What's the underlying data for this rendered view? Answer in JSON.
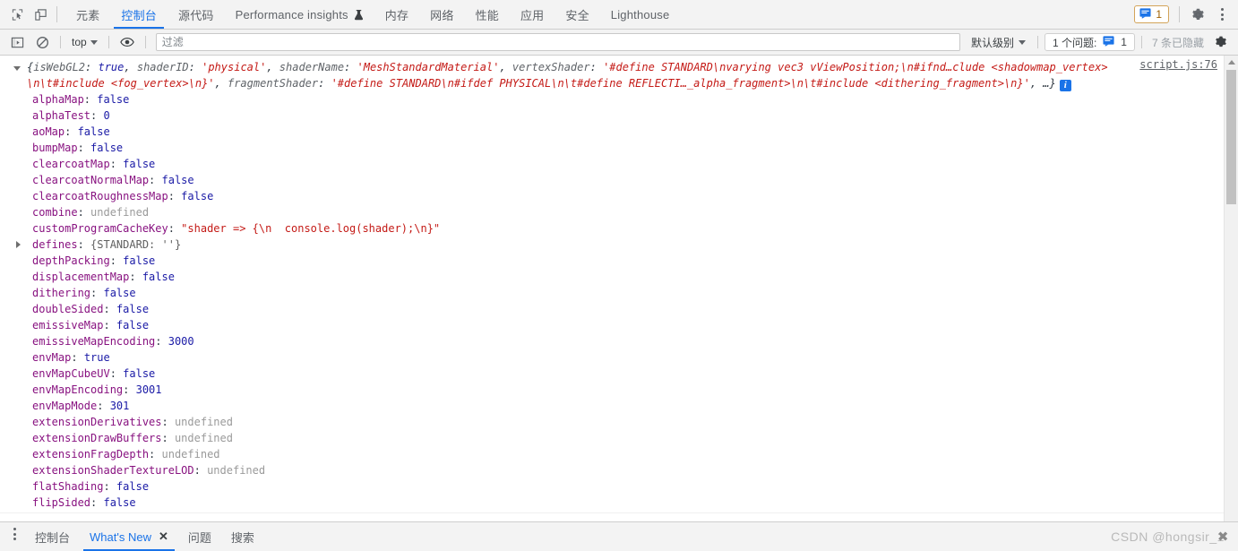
{
  "toolbar": {
    "inspect_icon": "inspect-cursor-icon",
    "device_icon": "device-toolbar-icon",
    "tabs": [
      {
        "label": "元素",
        "active": false
      },
      {
        "label": "控制台",
        "active": true
      },
      {
        "label": "源代码",
        "active": false
      },
      {
        "label": "Performance insights",
        "active": false,
        "flask": true
      },
      {
        "label": "内存",
        "active": false
      },
      {
        "label": "网络",
        "active": false
      },
      {
        "label": "性能",
        "active": false
      },
      {
        "label": "应用",
        "active": false
      },
      {
        "label": "安全",
        "active": false
      },
      {
        "label": "Lighthouse",
        "active": false
      }
    ],
    "issue_chip_count": "1",
    "settings_icon": "gear-icon",
    "more_icon": "more-vertical-icon"
  },
  "filterbar": {
    "sidebar_toggle_icon": "console-sidebar-icon",
    "clear_icon": "clear-console-icon",
    "context": "top",
    "eye_icon": "live-expression-icon",
    "filter_placeholder": "过滤",
    "filter_value": "",
    "level": "默认级别",
    "issues_label": "1 个问题:",
    "issues_count": "1",
    "hidden_label": "7 条已隐藏",
    "settings_icon": "console-settings-icon"
  },
  "console": {
    "source_link": "script.js:76",
    "preview": {
      "open_brace": "{",
      "tokens": [
        {
          "t": "key",
          "v": "isWebGL2"
        },
        {
          "t": "punc",
          "v": ": "
        },
        {
          "t": "bool",
          "v": "true"
        },
        {
          "t": "punc",
          "v": ", "
        },
        {
          "t": "key",
          "v": "shaderID"
        },
        {
          "t": "punc",
          "v": ": "
        },
        {
          "t": "str",
          "v": "'physical'"
        },
        {
          "t": "punc",
          "v": ", "
        },
        {
          "t": "key",
          "v": "shaderName"
        },
        {
          "t": "punc",
          "v": ": "
        },
        {
          "t": "str",
          "v": "'MeshStandardMaterial'"
        },
        {
          "t": "punc",
          "v": ", "
        },
        {
          "t": "key",
          "v": "vertexShader"
        },
        {
          "t": "punc",
          "v": ": "
        },
        {
          "t": "str",
          "v": "'#define STANDARD\\nvarying vec3 vViewPosition;\\n#ifnd…clude <shadowmap_vertex>\\n\\t#include <fog_vertex>\\n}'"
        },
        {
          "t": "punc",
          "v": ", "
        },
        {
          "t": "key",
          "v": "fragmentShader"
        },
        {
          "t": "punc",
          "v": ": "
        },
        {
          "t": "str",
          "v": "'#define STANDARD\\n#ifdef PHYSICAL\\n\\t#define REFLECTI…_alpha_fragment>\\n\\t#include <dithering_fragment>\\n}'"
        },
        {
          "t": "punc",
          "v": ", …}"
        }
      ]
    },
    "properties": [
      {
        "name": "alphaMap",
        "value": "false",
        "type": "bool"
      },
      {
        "name": "alphaTest",
        "value": "0",
        "type": "num"
      },
      {
        "name": "aoMap",
        "value": "false",
        "type": "bool"
      },
      {
        "name": "bumpMap",
        "value": "false",
        "type": "bool"
      },
      {
        "name": "clearcoatMap",
        "value": "false",
        "type": "bool"
      },
      {
        "name": "clearcoatNormalMap",
        "value": "false",
        "type": "bool"
      },
      {
        "name": "clearcoatRoughnessMap",
        "value": "false",
        "type": "bool"
      },
      {
        "name": "combine",
        "value": "undefined",
        "type": "undef"
      },
      {
        "name": "customProgramCacheKey",
        "value": "\"shader => {\\n  console.log(shader);\\n}\"",
        "type": "str"
      },
      {
        "name": "defines",
        "value": "{STANDARD: ''}",
        "type": "obj",
        "expandable": true
      },
      {
        "name": "depthPacking",
        "value": "false",
        "type": "bool"
      },
      {
        "name": "displacementMap",
        "value": "false",
        "type": "bool"
      },
      {
        "name": "dithering",
        "value": "false",
        "type": "bool"
      },
      {
        "name": "doubleSided",
        "value": "false",
        "type": "bool"
      },
      {
        "name": "emissiveMap",
        "value": "false",
        "type": "bool"
      },
      {
        "name": "emissiveMapEncoding",
        "value": "3000",
        "type": "num"
      },
      {
        "name": "envMap",
        "value": "true",
        "type": "bool"
      },
      {
        "name": "envMapCubeUV",
        "value": "false",
        "type": "bool"
      },
      {
        "name": "envMapEncoding",
        "value": "3001",
        "type": "num"
      },
      {
        "name": "envMapMode",
        "value": "301",
        "type": "num"
      },
      {
        "name": "extensionDerivatives",
        "value": "undefined",
        "type": "undef"
      },
      {
        "name": "extensionDrawBuffers",
        "value": "undefined",
        "type": "undef"
      },
      {
        "name": "extensionFragDepth",
        "value": "undefined",
        "type": "undef"
      },
      {
        "name": "extensionShaderTextureLOD",
        "value": "undefined",
        "type": "undef"
      },
      {
        "name": "flatShading",
        "value": "false",
        "type": "bool"
      },
      {
        "name": "flipSided",
        "value": "false",
        "type": "bool"
      }
    ]
  },
  "drawer": {
    "more_icon": "more-vertical-icon",
    "tabs": [
      {
        "label": "控制台",
        "active": false,
        "closable": false
      },
      {
        "label": "What's New",
        "active": true,
        "closable": true
      },
      {
        "label": "问题",
        "active": false,
        "closable": false
      },
      {
        "label": "搜索",
        "active": false,
        "closable": false
      }
    ],
    "close_label": "✕"
  },
  "watermark": {
    "text": "CSDN @hongsir_1",
    "mark": "✖"
  },
  "colors": {
    "accent": "#1a73e8",
    "property_name": "#881280",
    "string": "#c41a16",
    "number": "#1a1aa6",
    "undefined": "#9a9a9a",
    "toolbar_bg": "#f3f3f3"
  }
}
